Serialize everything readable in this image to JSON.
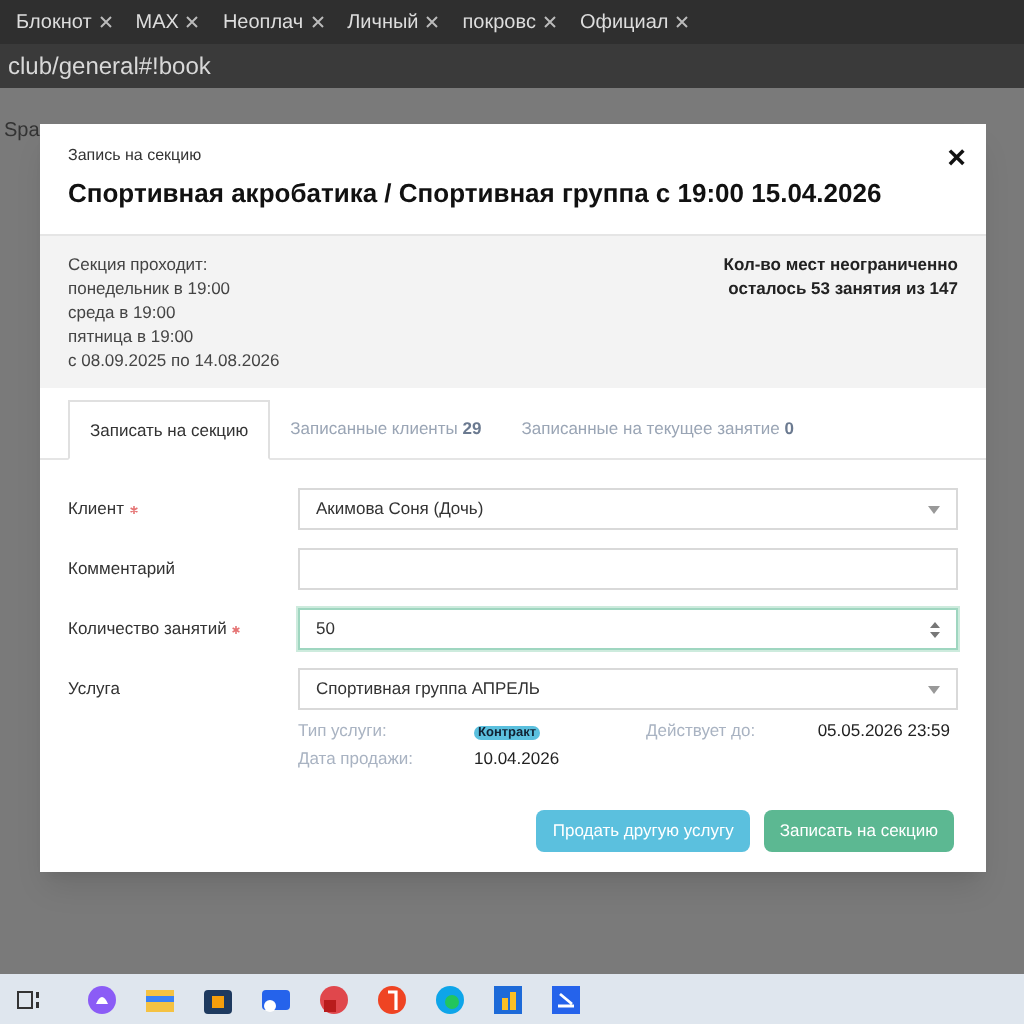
{
  "browser_tabs": [
    {
      "title": "Блокнот",
      "selected": false
    },
    {
      "title": "MAX",
      "selected": false
    },
    {
      "title": "Неоплач",
      "selected": false
    },
    {
      "title": "Личный",
      "selected": false
    },
    {
      "title": "покровс",
      "selected": false
    },
    {
      "title": "Официал",
      "selected": false
    }
  ],
  "address": "club/general#!book",
  "background_text": "Spa",
  "modal": {
    "subtitle": "Запись на секцию",
    "title": "Спортивная акробатика / Спортивная группа с 19:00 15.04.2026",
    "close": "×",
    "schedule": [
      "Секция проходит:",
      "понедельник в 19:00",
      "среда в 19:00",
      "пятница в 19:00",
      "с 08.09.2025 по 14.08.2026"
    ],
    "capacity": [
      "Кол-во мест неограниченно",
      "осталось 53 занятия из 147"
    ],
    "tabs": [
      {
        "label": "Записать на секцию",
        "selected": true
      },
      {
        "label": "Записанные клиенты",
        "count": "29",
        "selected": false
      },
      {
        "label": "Записанные на текущее занятие",
        "count": "0",
        "selected": false
      }
    ],
    "fields": [
      {
        "kind": "select",
        "label": "Клиент",
        "required": true,
        "value": "Акимова Соня (Дочь)"
      },
      {
        "kind": "text",
        "label": "Комментарий",
        "required": false
      },
      {
        "kind": "number",
        "label": "Количество занятий",
        "required": true,
        "value": "50",
        "focused": true
      },
      {
        "kind": "select",
        "label": "Услуга",
        "required": false,
        "value": "Спортивная группа АПРЕЛЬ"
      }
    ],
    "service_info": {
      "type_label": "Тип услуги:",
      "type_badge": "Контракт",
      "valid_label": "Действует до:",
      "valid_value": "05.05.2026 23:59",
      "sold_label": "Дата продажи:",
      "sold_value": "10.04.2026"
    },
    "buttons": [
      {
        "kind": "info",
        "label": "Продать другую услугу"
      },
      {
        "kind": "primary",
        "label": "Записать на секцию"
      }
    ]
  }
}
